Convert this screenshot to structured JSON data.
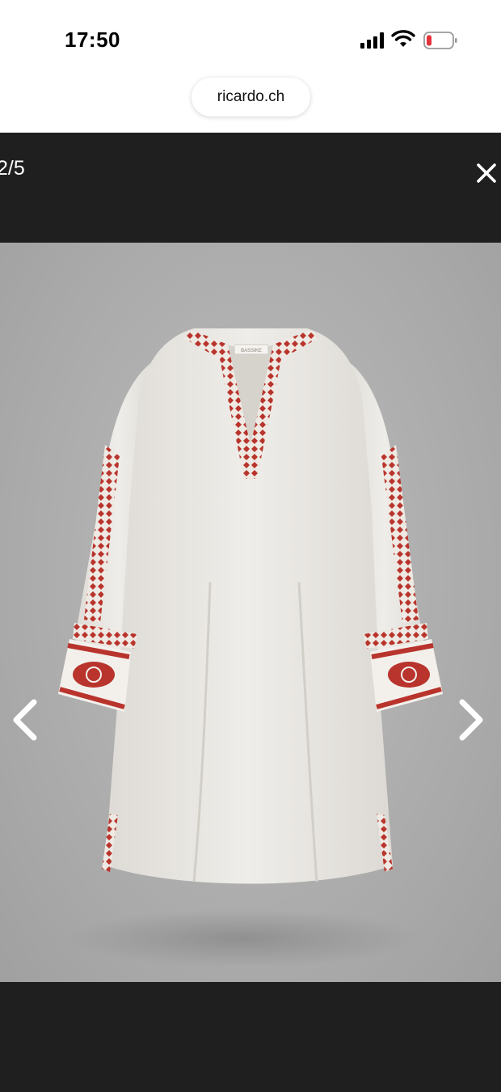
{
  "status_bar": {
    "time": "17:50",
    "signal_icon": "cellular-signal-icon",
    "wifi_icon": "wifi-icon",
    "battery_icon": "battery-low-icon",
    "battery_color": "#e5333b"
  },
  "browser": {
    "url": "ricardo.ch"
  },
  "lightbox": {
    "counter": "2/5",
    "close_icon": "close-icon",
    "prev_icon": "chevron-left-icon",
    "next_icon": "chevron-right-icon",
    "background_color": "#1f1f1f"
  },
  "image": {
    "subject": "white linen tunic dress with red embroidery",
    "label_text": "BASSIKE",
    "accent_color": "#b8342c"
  }
}
